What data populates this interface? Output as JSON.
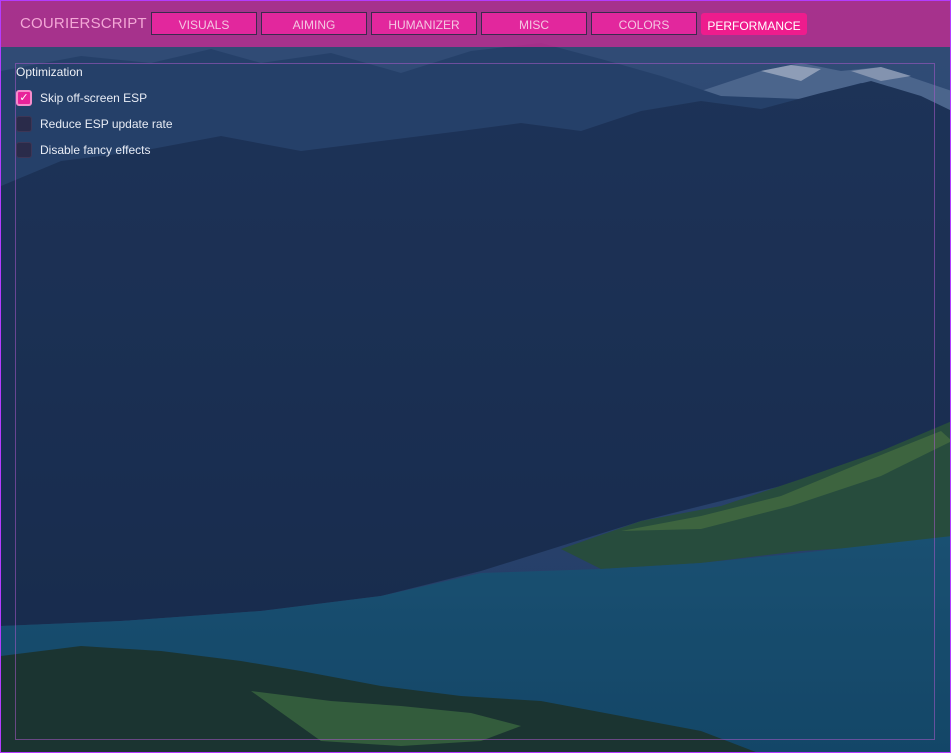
{
  "app": {
    "title": "COURIERSCRIPT"
  },
  "tabs": [
    {
      "label": "VISUALS",
      "active": false
    },
    {
      "label": "AIMING",
      "active": false
    },
    {
      "label": "HUMANIZER",
      "active": false
    },
    {
      "label": "MISC",
      "active": false
    },
    {
      "label": "COLORS",
      "active": false
    },
    {
      "label": "PERFORMANCE",
      "active": true
    }
  ],
  "optimization": {
    "title": "Optimization",
    "options": [
      {
        "label": "Skip off-screen ESP",
        "checked": true
      },
      {
        "label": "Reduce ESP update rate",
        "checked": false
      },
      {
        "label": "Disable fancy effects",
        "checked": false
      }
    ]
  },
  "colors": {
    "accent": "#ee1c8d",
    "header": "#d42896",
    "frame": "#b33cff",
    "check_icon": "check-icon"
  }
}
